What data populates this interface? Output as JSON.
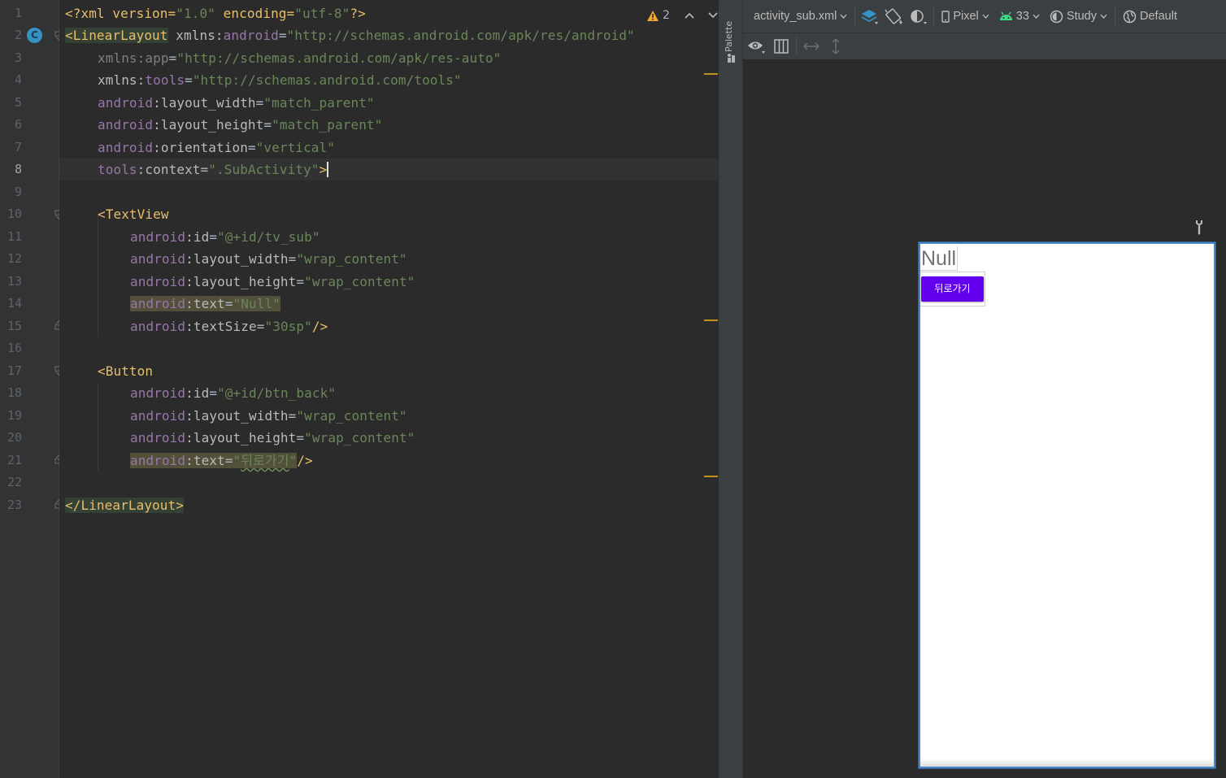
{
  "editor": {
    "line_numbers": [
      "1",
      "2",
      "3",
      "4",
      "5",
      "6",
      "7",
      "8",
      "9",
      "10",
      "11",
      "12",
      "13",
      "14",
      "15",
      "16",
      "17",
      "18",
      "19",
      "20",
      "21",
      "22",
      "23"
    ],
    "current_line": "8",
    "gutter_class_icon": "C",
    "warnings_count": "2",
    "code": {
      "l1": {
        "a": "<?xml version=",
        "b": "\"1.0\"",
        "c": " encoding=",
        "d": "\"utf-8\"",
        "e": "?>"
      },
      "l2": {
        "tag": "<LinearLayout",
        "attr": " xmlns:",
        "ns": "android",
        "eq": "=",
        "val": "\"http://schemas.android.com/apk/res/android\""
      },
      "l3": {
        "attr": "xmlns:app",
        "eq": "=",
        "val": "\"http://schemas.android.com/apk/res-auto\""
      },
      "l4": {
        "attr": "xmlns:",
        "ns": "tools",
        "eq": "=",
        "val": "\"http://schemas.android.com/tools\""
      },
      "l5": {
        "ns": "android",
        "attr": ":layout_width",
        "eq": "=",
        "val": "\"match_parent\""
      },
      "l6": {
        "ns": "android",
        "attr": ":layout_height",
        "eq": "=",
        "val": "\"match_parent\""
      },
      "l7": {
        "ns": "android",
        "attr": ":orientation",
        "eq": "=",
        "val": "\"vertical\""
      },
      "l8": {
        "ns": "tools",
        "attr": ":context",
        "eq": "=",
        "val": "\".SubActivity\"",
        "end": ">"
      },
      "l10": {
        "tag": "<TextView"
      },
      "l11": {
        "ns": "android",
        "attr": ":id",
        "eq": "=",
        "val": "\"@+id/tv_sub\""
      },
      "l12": {
        "ns": "android",
        "attr": ":layout_width",
        "eq": "=",
        "val": "\"wrap_content\""
      },
      "l13": {
        "ns": "android",
        "attr": ":layout_height",
        "eq": "=",
        "val": "\"wrap_content\""
      },
      "l14": {
        "ns": "android",
        "attr": ":text",
        "eq": "=",
        "val": "\"Null\""
      },
      "l15": {
        "ns": "android",
        "attr": ":textSize",
        "eq": "=",
        "val": "\"30sp\"",
        "end": "/>"
      },
      "l17": {
        "tag": "<Button"
      },
      "l18": {
        "ns": "android",
        "attr": ":id",
        "eq": "=",
        "val": "\"@+id/btn_back\""
      },
      "l19": {
        "ns": "android",
        "attr": ":layout_width",
        "eq": "=",
        "val": "\"wrap_content\""
      },
      "l20": {
        "ns": "android",
        "attr": ":layout_height",
        "eq": "=",
        "val": "\"wrap_content\""
      },
      "l21": {
        "ns": "android",
        "attr": ":text",
        "eq": "=",
        "val_q1": "\"",
        "val_ko": "뒤로가기",
        "val_q2": "\"",
        "end": "/>"
      },
      "l23": {
        "tag": "</LinearLayout>"
      }
    }
  },
  "palette": {
    "label": "Palette"
  },
  "toolbar": {
    "file_name": "activity_sub.xml",
    "device": "Pixel",
    "api_level": "33",
    "theme": "Study",
    "locale": "Default"
  },
  "preview": {
    "textview_text": "Null",
    "button_text": "뒤로가기"
  },
  "colors": {
    "accent_button": "#6200ee",
    "warning": "#be9117",
    "selection_border": "#4a86c8"
  }
}
